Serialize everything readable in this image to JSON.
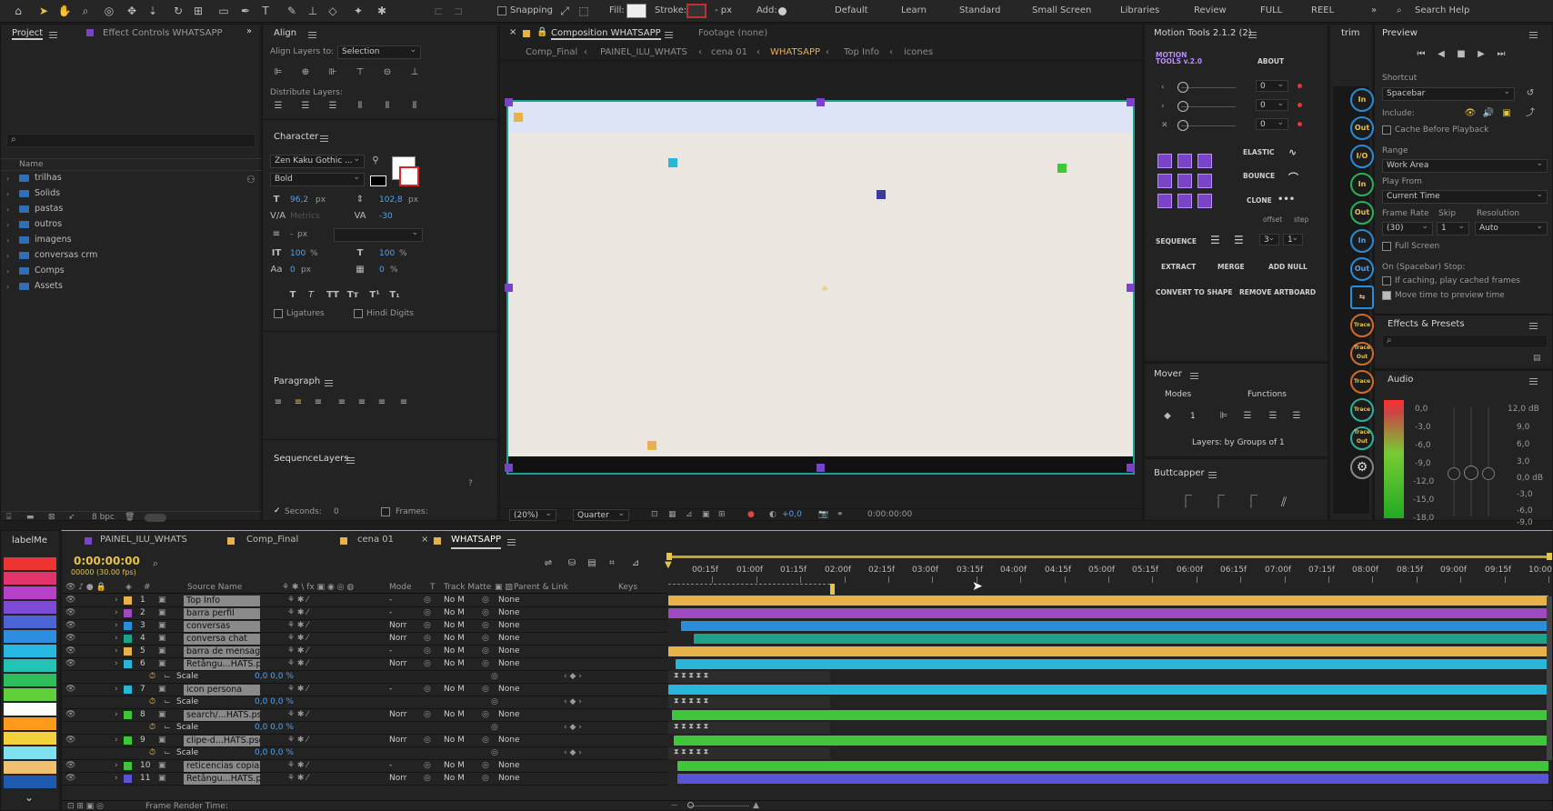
{
  "toolbar": {
    "snapping": "Snapping",
    "fill": "Fill:",
    "stroke": "Stroke:",
    "stroke_px": "- px",
    "add": "Add:",
    "workspaces": [
      "Default",
      "Learn",
      "Standard",
      "Small Screen",
      "Libraries",
      "Review",
      "FULL",
      "REEL"
    ],
    "search_help": "Search Help"
  },
  "project": {
    "tab": "Project",
    "effect_controls": "Effect Controls WHATSAPP",
    "name_col": "Name",
    "items": [
      "trilhas",
      "Solids",
      "pastas",
      "outros",
      "imagens",
      "conversas crm",
      "Comps",
      "Assets"
    ],
    "bpc": "8 bpc"
  },
  "align": {
    "title": "Align",
    "align_layers_to": "Align Layers to:",
    "selection": "Selection",
    "distribute": "Distribute Layers:"
  },
  "character": {
    "title": "Character",
    "font": "Zen Kaku Gothic ...",
    "style": "Bold",
    "size": "96,2",
    "size_unit": "px",
    "leading": "102,8",
    "leading_unit": "px",
    "kerning": "Metrics",
    "tracking": "-30",
    "stroke_w": "-",
    "stroke_unit": "px",
    "vscale": "100",
    "vscale_unit": "%",
    "hscale": "100",
    "hscale_unit": "%",
    "baseline": "0",
    "baseline_unit": "px",
    "tsume": "0",
    "tsume_unit": "%",
    "ligatures": "Ligatures",
    "hindi": "Hindi Digits"
  },
  "paragraph": {
    "title": "Paragraph"
  },
  "sequence_layers": {
    "title": "SequenceLayers",
    "help": "?",
    "seconds_label": "Seconds:",
    "seconds_val": "0",
    "frames_label": "Frames:"
  },
  "composition": {
    "tab": "Composition WHATSAPP",
    "footage": "Footage (none)",
    "breadcrumbs": [
      "Comp_Final",
      "PAINEL_ILU_WHATS",
      "cena 01",
      "WHATSAPP",
      "Top Info",
      "icones"
    ],
    "zoom": "(20%)",
    "quality": "Quarter",
    "exposure": "+0,0",
    "timecode": "0:00:00:00"
  },
  "motion_tools": {
    "title": "Motion Tools 2.1.2 (2)",
    "logo": "MOTION TOOLS v.2.0",
    "about": "ABOUT",
    "vals": [
      "0",
      "0",
      "0"
    ],
    "elastic": "ELASTIC",
    "bounce": "BOUNCE",
    "clone": "CLONE",
    "offset": "offset",
    "step": "step",
    "sequence": "SEQUENCE",
    "seq_offset": "3",
    "seq_step": "1",
    "extract": "EXTRACT",
    "merge": "MERGE",
    "add_null": "ADD NULL",
    "convert": "CONVERT TO SHAPE",
    "remove_artboard": "REMOVE ARTBOARD"
  },
  "mover": {
    "title": "Mover",
    "modes": "Modes",
    "functions": "Functions",
    "count": "1",
    "layers_by": "Layers: by Groups of 1"
  },
  "buttcapper": {
    "title": "Buttcapper"
  },
  "trim": {
    "title": "trim",
    "buttons": [
      "In",
      "Out",
      "I/O",
      "In",
      "Out",
      "In",
      "Out",
      "⇆",
      "Trace",
      "Trace Out",
      "Trace",
      "Trace",
      "Trace Out",
      "⚙"
    ]
  },
  "preview": {
    "title": "Preview",
    "shortcut": "Shortcut",
    "shortcut_val": "Spacebar",
    "include": "Include:",
    "cache": "Cache Before Playback",
    "range": "Range",
    "range_val": "Work Area",
    "play_from": "Play From",
    "play_from_val": "Current Time",
    "frame_rate": "Frame Rate",
    "skip": "Skip",
    "resolution": "Resolution",
    "fr_val": "(30)",
    "skip_val": "1",
    "res_val": "Auto",
    "full_screen": "Full Screen",
    "on_stop": "On (Spacebar) Stop:",
    "if_caching": "If caching, play cached frames",
    "move_time": "Move time to preview time"
  },
  "effects": {
    "title": "Effects & Presets"
  },
  "audio": {
    "title": "Audio",
    "left_scale": [
      "0,0",
      "-3,0",
      "-6,0",
      "-9,0",
      "-12,0",
      "-15,0",
      "-18,0"
    ],
    "right_scale": [
      "12,0 dB",
      "9,0",
      "6,0",
      "3,0",
      "0,0 dB",
      "-3,0",
      "-6,0",
      "-9,0"
    ]
  },
  "timeline": {
    "labels_title": "labelMe",
    "tabs": [
      "PAINEL_ILU_WHATS",
      "Comp_Final",
      "cena 01",
      "WHATSAPP"
    ],
    "timecode": "0:00:00:00",
    "fps": "00000 (30.00 fps)",
    "cols": {
      "source": "Source Name",
      "mode": "Mode",
      "t": "T",
      "matte": "Track Matte",
      "parent": "Parent & Link",
      "keys": "Keys"
    },
    "ruler": [
      "00:15f",
      "01:00f",
      "01:15f",
      "02:00f",
      "02:15f",
      "03:00f",
      "03:15f",
      "04:00f",
      "04:15f",
      "05:00f",
      "05:15f",
      "06:00f",
      "06:15f",
      "07:00f",
      "07:15f",
      "08:00f",
      "08:15f",
      "09:00f",
      "09:15f",
      "10:00"
    ],
    "layers": [
      {
        "num": "1",
        "name": "Top Info",
        "mode": "-",
        "matte": "No M",
        "parent": "None",
        "color": "#e8b24a"
      },
      {
        "num": "2",
        "name": "barra perfil",
        "mode": "-",
        "matte": "No M",
        "parent": "None",
        "color": "#a04ac2"
      },
      {
        "num": "3",
        "name": "conversas",
        "mode": "Norr",
        "matte": "No M",
        "parent": "None",
        "color": "#2a8fd8"
      },
      {
        "num": "4",
        "name": "conversa chat",
        "mode": "Norr",
        "matte": "No M",
        "parent": "None",
        "color": "#1ea38a"
      },
      {
        "num": "5",
        "name": "barra de mensagem",
        "mode": "-",
        "matte": "No M",
        "parent": "None",
        "color": "#e8b24a"
      },
      {
        "num": "6",
        "name": "Retângu...HATS.psd",
        "mode": "Norr",
        "matte": "No M",
        "parent": "None",
        "color": "#2ab6d8"
      },
      {
        "num": "",
        "name": "Scale",
        "sub": true,
        "val": "0,0 0,0 %"
      },
      {
        "num": "7",
        "name": "icon persona",
        "mode": "-",
        "matte": "No M",
        "parent": "None",
        "color": "#2ab6d8"
      },
      {
        "num": "",
        "name": "Scale",
        "sub": true,
        "val": "0,0 0,0 %"
      },
      {
        "num": "8",
        "name": "search/...HATS.psd",
        "mode": "Norr",
        "matte": "No M",
        "parent": "None",
        "color": "#3fc63a"
      },
      {
        "num": "",
        "name": "Scale",
        "sub": true,
        "val": "0,0 0,0 %"
      },
      {
        "num": "9",
        "name": "clipe-d...HATS.psd",
        "mode": "Norr",
        "matte": "No M",
        "parent": "None",
        "color": "#3fc63a"
      },
      {
        "num": "",
        "name": "Scale",
        "sub": true,
        "val": "0,0 0,0 %"
      },
      {
        "num": "10",
        "name": "reticencias copiar",
        "mode": "-",
        "matte": "No M",
        "parent": "None",
        "color": "#3fc63a"
      },
      {
        "num": "11",
        "name": "Retângu...HATS.psd",
        "mode": "Norr",
        "matte": "No M",
        "parent": "None",
        "color": "#5a55d6"
      }
    ],
    "frame_render": "Frame Render Time:"
  },
  "label_colors": [
    "#e33",
    "#e2336b",
    "#b640c7",
    "#7d4ad6",
    "#4a64d6",
    "#2d8ee0",
    "#26b8e0",
    "#22c2b4",
    "#2fbd5c",
    "#60cf3a",
    "#ffffff",
    "#ff9a1a",
    "#f2d13c",
    "#7fe0f0",
    "#f0c070",
    "#1d5ab0"
  ]
}
